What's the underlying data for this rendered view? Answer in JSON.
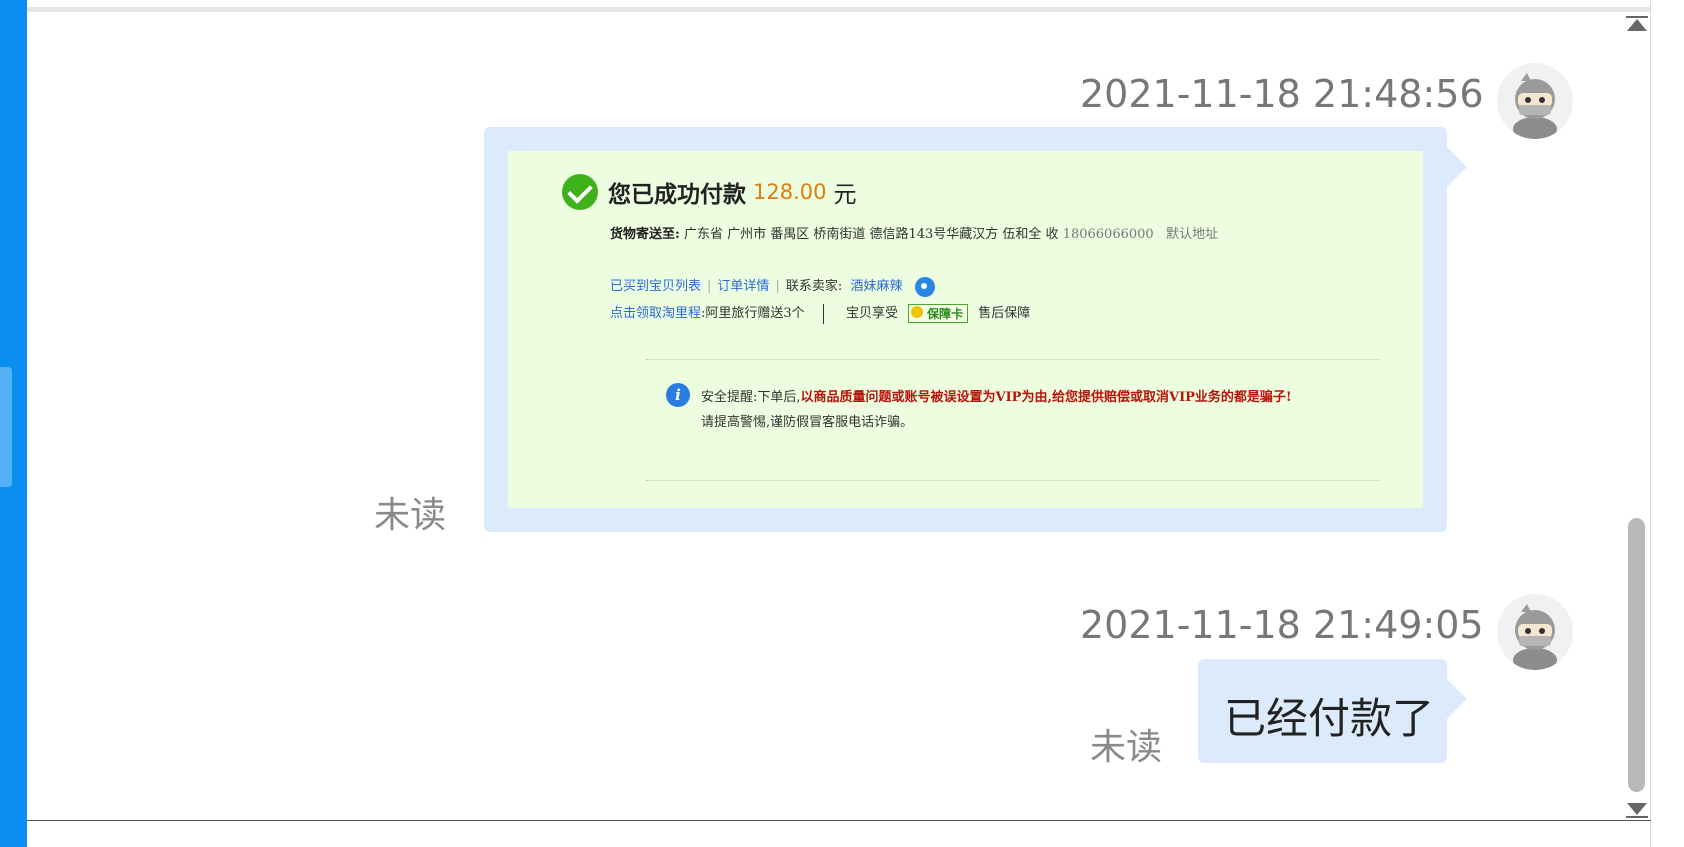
{
  "messages": [
    {
      "timestamp": "2021-11-18 21:48:56",
      "unread": "未读",
      "card": {
        "paid_text": "您已成功付款",
        "amount": "128.00",
        "unit": "元",
        "address_label": "货物寄送至:",
        "address": "广东省 广州市 番禺区 桥南街道 德信路143号华藏汉方 伍和全 收",
        "phone": "18066066000",
        "default_addr": "默认地址",
        "link_bought": "已买到宝贝列表",
        "link_order": "订单详情",
        "contact_label": "联系卖家:",
        "seller": "酒妹麻辣",
        "miles_link": "点击领取淘里程",
        "miles_text": ":阿里旅行赠送3个",
        "enjoy_text": "宝贝享受",
        "badge": "保障卡",
        "after_sale": "售后保障",
        "safety_prefix": "安全提醒:下单后,",
        "safety_warning": "以商品质量问题或账号被误设置为VIP为由,给您提供赔偿或取消VIP业务的都是骗子!",
        "safety_tip": "请提高警惕,谨防假冒客服电话诈骗。"
      }
    },
    {
      "timestamp": "2021-11-18 21:49:05",
      "unread": "未读",
      "text": "已经付款了"
    }
  ],
  "colors": {
    "sidebar": "#0a8ef0",
    "bubble": "#dcebfc",
    "card": "#edfde0",
    "amount": "#e07b0c",
    "link": "#2b6bd4",
    "warning": "#b8140c"
  }
}
